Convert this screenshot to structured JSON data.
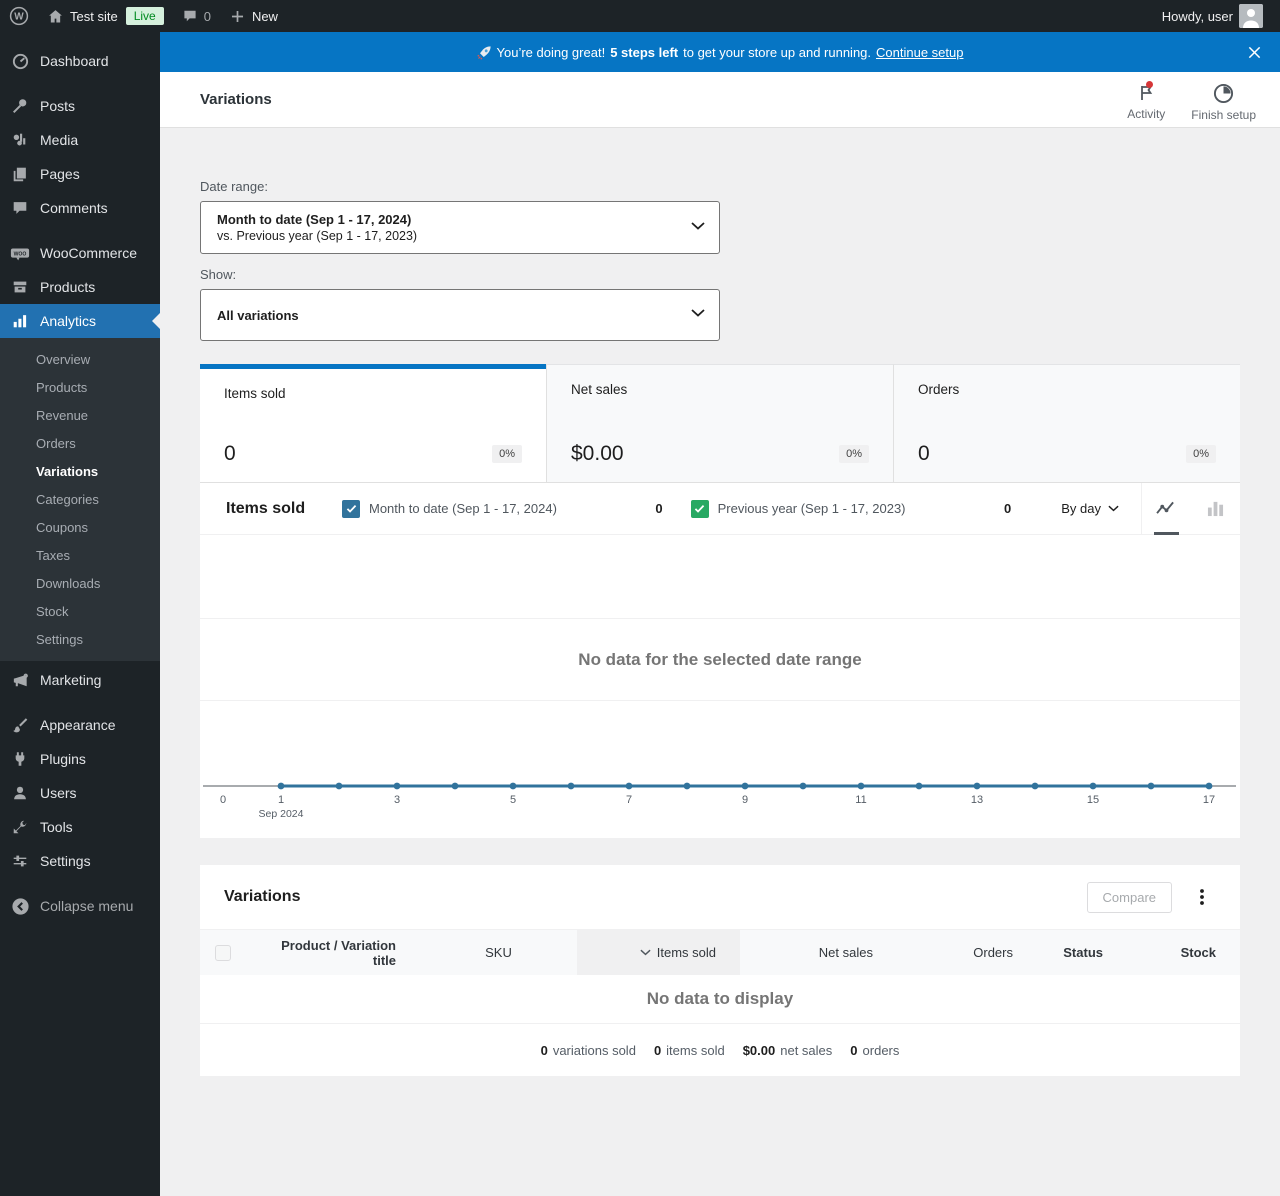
{
  "colors": {
    "accent_blue": "#0675c4",
    "menu_active_blue": "#2271b1",
    "chart_primary": "#31739c",
    "chart_secondary": "#28a963",
    "admin_dark": "#1d2327"
  },
  "admin_bar": {
    "site_name": "Test site",
    "live_badge": "Live",
    "comment_count": "0",
    "new_label": "New",
    "howdy": "Howdy, user",
    "icons": [
      "wordpress-logo-icon",
      "home-icon",
      "comments-bubble-icon",
      "plus-icon",
      "avatar"
    ]
  },
  "sidebar": {
    "items": [
      {
        "label": "Dashboard",
        "icon": "dashboard-icon"
      },
      {
        "label": "Posts",
        "icon": "pin-icon"
      },
      {
        "label": "Media",
        "icon": "media-icon"
      },
      {
        "label": "Pages",
        "icon": "pages-icon"
      },
      {
        "label": "Comments",
        "icon": "comment-icon"
      },
      {
        "label": "WooCommerce",
        "icon": "woocommerce-icon"
      },
      {
        "label": "Products",
        "icon": "products-box-icon"
      },
      {
        "label": "Analytics",
        "icon": "bar-chart-icon",
        "active": true
      },
      {
        "label": "Marketing",
        "icon": "megaphone-icon"
      },
      {
        "label": "Appearance",
        "icon": "brush-icon"
      },
      {
        "label": "Plugins",
        "icon": "plug-icon"
      },
      {
        "label": "Users",
        "icon": "user-icon"
      },
      {
        "label": "Tools",
        "icon": "wrench-icon"
      },
      {
        "label": "Settings",
        "icon": "sliders-icon"
      },
      {
        "label": "Collapse menu",
        "icon": "collapse-arrow-icon"
      }
    ],
    "analytics_submenu": [
      "Overview",
      "Products",
      "Revenue",
      "Orders",
      "Variations",
      "Categories",
      "Coupons",
      "Taxes",
      "Downloads",
      "Stock",
      "Settings"
    ],
    "active_submenu_item": "Variations"
  },
  "banner": {
    "icon": "rocket-icon",
    "message_pre": "You’re doing great!",
    "steps_bold": "5 steps left",
    "message_post": "to get your store up and running.",
    "link": "Continue setup",
    "close_icon": "close-icon"
  },
  "header": {
    "title": "Variations",
    "activity_label": "Activity",
    "finish_setup_label": "Finish setup"
  },
  "filters": {
    "date_range_label": "Date range:",
    "date_range_primary": "Month to date (Sep 1 - 17, 2024)",
    "date_range_secondary": "vs. Previous year (Sep 1 - 17, 2023)",
    "show_label": "Show:",
    "show_value": "All variations"
  },
  "stats": {
    "tabs": [
      {
        "label": "Items sold",
        "value": "0",
        "delta": "0%",
        "selected": true
      },
      {
        "label": "Net sales",
        "value": "$0.00",
        "delta": "0%",
        "selected": false
      },
      {
        "label": "Orders",
        "value": "0",
        "delta": "0%",
        "selected": false
      }
    ]
  },
  "chart": {
    "title": "Items sold",
    "toggles": [
      {
        "label": "Month to date (Sep 1 - 17, 2024)",
        "value": "0",
        "checked": true,
        "color": "#31739c"
      },
      {
        "label": "Previous year (Sep 1 - 17, 2023)",
        "value": "0",
        "checked": true,
        "color": "#28a963"
      }
    ],
    "interval": "By day",
    "empty_message": "No data for the selected date range"
  },
  "chart_data": {
    "type": "line",
    "title": "Items sold",
    "interval": "By day",
    "xlabel": "",
    "ylabel": "Items sold",
    "ylim": [
      0,
      1
    ],
    "grid": false,
    "legend_position": "top",
    "days": [
      1,
      2,
      3,
      4,
      5,
      6,
      7,
      8,
      9,
      10,
      11,
      12,
      13,
      14,
      15,
      16,
      17
    ],
    "series": [
      {
        "name": "Month to date (Sep 1 - 17, 2024)",
        "color": "#31739c",
        "total": 0,
        "values": [
          0,
          0,
          0,
          0,
          0,
          0,
          0,
          0,
          0,
          0,
          0,
          0,
          0,
          0,
          0,
          0,
          0
        ]
      },
      {
        "name": "Previous year (Sep 1 - 17, 2023)",
        "color": "#28a963",
        "total": 0,
        "values": [
          0,
          0,
          0,
          0,
          0,
          0,
          0,
          0,
          0,
          0,
          0,
          0,
          0,
          0,
          0,
          0,
          0
        ]
      }
    ],
    "x_ticks": [
      {
        "pos": 0,
        "label": "0"
      },
      {
        "pos": 1,
        "label": "1",
        "sub": "Sep 2024"
      },
      {
        "pos": 3,
        "label": "3"
      },
      {
        "pos": 5,
        "label": "5"
      },
      {
        "pos": 7,
        "label": "7"
      },
      {
        "pos": 9,
        "label": "9"
      },
      {
        "pos": 11,
        "label": "11"
      },
      {
        "pos": 13,
        "label": "13"
      },
      {
        "pos": 15,
        "label": "15"
      },
      {
        "pos": 17,
        "label": "17"
      }
    ],
    "empty_message": "No data for the selected date range"
  },
  "table": {
    "title": "Variations",
    "compare_label": "Compare",
    "columns": [
      {
        "label": "Product / Variation title",
        "bold": true
      },
      {
        "label": "SKU",
        "bold": false
      },
      {
        "label": "Items sold",
        "bold": false,
        "sorted": "desc"
      },
      {
        "label": "Net sales",
        "bold": false
      },
      {
        "label": "Orders",
        "bold": false
      },
      {
        "label": "Status",
        "bold": true
      },
      {
        "label": "Stock",
        "bold": true
      }
    ],
    "empty_message": "No data to display",
    "summary": [
      {
        "value": "0",
        "label": "variations sold"
      },
      {
        "value": "0",
        "label": "items sold"
      },
      {
        "value": "$0.00",
        "label": "net sales"
      },
      {
        "value": "0",
        "label": "orders"
      }
    ]
  }
}
